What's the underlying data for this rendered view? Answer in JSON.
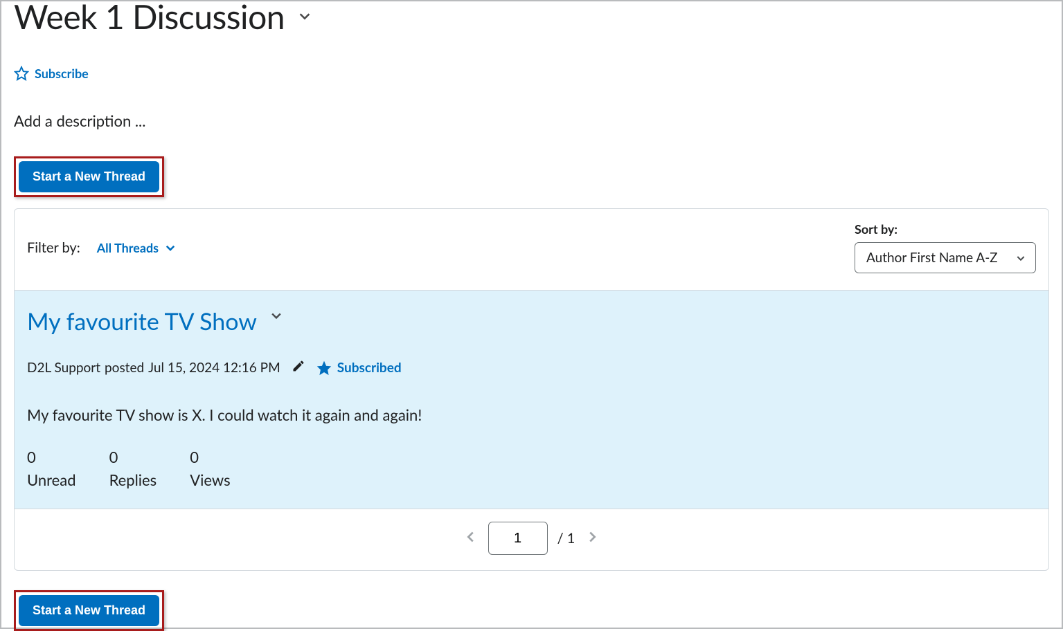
{
  "page": {
    "title": "Week 1 Discussion",
    "subscribe_label": "Subscribe",
    "description_placeholder": "Add a description ..."
  },
  "actions": {
    "new_thread_label": "Start a New Thread"
  },
  "filter": {
    "label": "Filter by:",
    "value": "All Threads"
  },
  "sort": {
    "label": "Sort by:",
    "value": "Author First Name A-Z"
  },
  "thread": {
    "title": "My favourite TV Show",
    "author": "D2L Support",
    "posted_prefix": "posted",
    "posted_at": "Jul 15, 2024 12:16 PM",
    "subscribed_label": "Subscribed",
    "body": "My favourite TV show is X. I could watch it again and again!",
    "stats": {
      "unread": {
        "value": "0",
        "label": "Unread"
      },
      "replies": {
        "value": "0",
        "label": "Replies"
      },
      "views": {
        "value": "0",
        "label": "Views"
      }
    }
  },
  "pagination": {
    "current": "1",
    "total": "1"
  }
}
